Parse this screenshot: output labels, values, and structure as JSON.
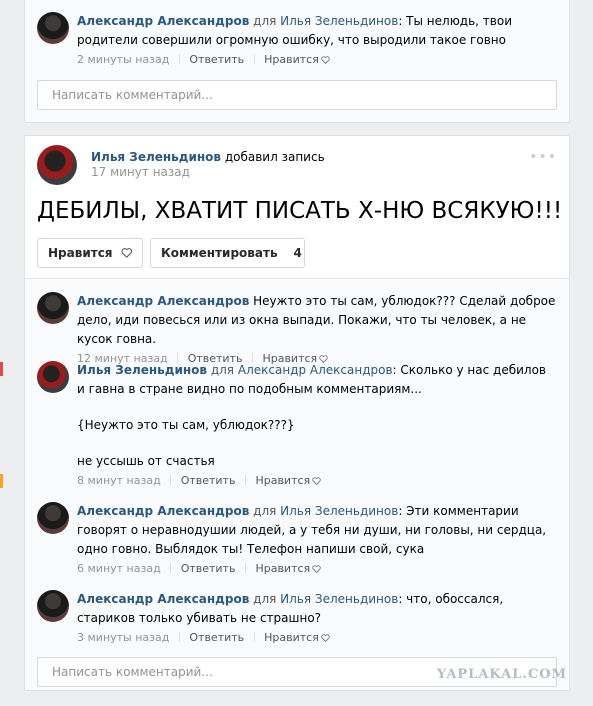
{
  "top_card": {
    "comment": {
      "author": "Александр Александров",
      "prep": "для",
      "target": "Илья Зеленьдинов",
      "text": ": Ты нелюдь, твои родители совершили огромную ошибку, что выродили такое говно",
      "time": "2 минуты назад",
      "reply": "Ответить",
      "like": "Нравится"
    },
    "input_placeholder": "Написать комментарий..."
  },
  "post": {
    "author": "Илья Зеленьдинов",
    "action": "добавил запись",
    "time": "17 минут назад",
    "text": "ДЕБИЛЫ, ХВАТИТ ПИСАТЬ Х-НЮ ВСЯКУЮ!!!",
    "like_button": "Нравится",
    "comment_button": "Комментировать",
    "comment_count": "4",
    "more_icon": "more-dots-icon"
  },
  "comments": [
    {
      "author": "Александр Александров",
      "text": "Неужто это ты сам, ублюдок??? Сделай доброе дело, иди повесься или из окна выпади. Покажи, что ты человек, а не кусок говна.",
      "time": "12 минут назад",
      "reply": "Ответить",
      "like": "Нравится"
    },
    {
      "author": "Илья Зеленьдинов",
      "prep": "для",
      "target": "Александр Александров",
      "text_line1": ": Сколько у нас дебилов и гавна в стране видно по подобным комментариям...",
      "text_line2": "{Неужто это ты сам, ублюдок???}",
      "text_line3": "не уссышь от счастья",
      "time": "8 минут назад",
      "reply": "Ответить",
      "like": "Нравится"
    },
    {
      "author": "Александр Александров",
      "prep": "для",
      "target": "Илья Зеленьдинов",
      "text": ": Эти комментарии говорят о неравнодушии людей, а у тебя ни души, ни головы, ни сердца, одно говно. Выблядок ты! Телефон напиши свой, сука",
      "time": "6 минут назад",
      "reply": "Ответить",
      "like": "Нравится"
    },
    {
      "author": "Александр Александров",
      "prep": "для",
      "target": "Илья Зеленьдинов",
      "text": ": что, обоссался, стариков только убивать не страшно?",
      "time": "3 минуты назад",
      "reply": "Ответить",
      "like": "Нравится"
    }
  ],
  "input_placeholder": "Написать комментарий...",
  "watermark": "YAPLAKAL.COM",
  "colors": {
    "link": "#2a5885",
    "meta": "#939393",
    "background": "#edeef0",
    "side_red": "#e64646",
    "side_orange": "#f5a623"
  }
}
